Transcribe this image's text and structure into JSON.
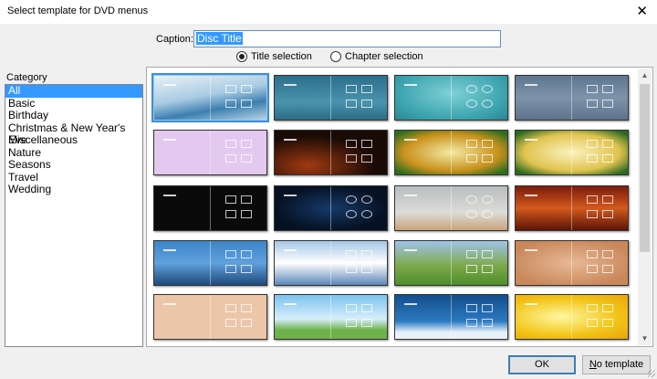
{
  "window": {
    "title": "Select template for DVD menus",
    "close_icon": "close-x-icon"
  },
  "caption": {
    "label": "Caption:",
    "value": "Disc Title"
  },
  "modes": [
    {
      "label": "Title selection",
      "selected": true
    },
    {
      "label": "Chapter selection",
      "selected": false
    }
  ],
  "category": {
    "label": "Category",
    "items": [
      "All",
      "Basic",
      "Birthday",
      "Christmas & New Year's Eve",
      "Miscellaneous",
      "Nature",
      "Seasons",
      "Travel",
      "Wedding"
    ],
    "selected": "All"
  },
  "templates": [
    {
      "bg": "linear-gradient(170deg,#e9f2f8 0%,#a9cbe2 45%,#3d7fb0 70%,#b7d3e6 100%)",
      "shape": "box",
      "selected": true
    },
    {
      "bg": "linear-gradient(180deg,#2c6f8c,#4a93ad 60%,#2a6c87)",
      "shape": "box"
    },
    {
      "bg": "radial-gradient(ellipse at 50% 40%,#7fd0d6,#3aa2ad 70%,#2b8691)",
      "shape": "circle"
    },
    {
      "bg": "linear-gradient(180deg,#5e7690,#7d93aa 50%,#5c738c)",
      "shape": "box"
    },
    {
      "bg": "#e3c9ef",
      "shape": "box"
    },
    {
      "bg": "radial-gradient(ellipse at 30% 80%,#a03a10,#1a0a05 60%)",
      "shape": "box"
    },
    {
      "bg": "radial-gradient(ellipse at 50% 50%,#f4e9a3,#c8911c 60%,#2e6e1e 90%)",
      "shape": "box"
    },
    {
      "bg": "radial-gradient(ellipse at 50% 50%,#fbf3c0,#e0c34e 60%,#2c6a22 90%)",
      "shape": "box"
    },
    {
      "bg": "#0a0a0a",
      "shape": "box"
    },
    {
      "bg": "radial-gradient(ellipse at 50% 50%,#163a6a,#061224 70%)",
      "shape": "circle"
    },
    {
      "bg": "linear-gradient(180deg,#b9bcbf,#dcdcd8 60%,#c9a37a)",
      "shape": "circle"
    },
    {
      "bg": "linear-gradient(180deg,#7a1b0c,#d45a1e 50%,#5a1408)",
      "shape": "box"
    },
    {
      "bg": "linear-gradient(180deg,#3d85c9,#5fa0dc 50%,#1f4a7c)",
      "shape": "box"
    },
    {
      "bg": "linear-gradient(180deg,#a4c6e6,#ffffff 50%,#5b86b9)",
      "shape": "box"
    },
    {
      "bg": "linear-gradient(180deg,#9fc4e9,#7fa94d 55%,#4e8e2b)",
      "shape": "box"
    },
    {
      "bg": "radial-gradient(ellipse at 50% 50%,#e7b995,#c9875a 80%)",
      "shape": "box"
    },
    {
      "bg": "#ecc6a9",
      "shape": "box"
    },
    {
      "bg": "linear-gradient(180deg,#7cc3ee,#d7eefb 55%,#6db24a 80%)",
      "shape": "box"
    },
    {
      "bg": "linear-gradient(180deg,#134e8c,#2c7ac1 60%,#e8f2fb 85%)",
      "shape": "box"
    },
    {
      "bg": "radial-gradient(ellipse at 40% 50%,#fff7a0,#f2c417 60%,#e8a40d)",
      "shape": "box"
    }
  ],
  "buttons": {
    "ok": "OK",
    "no_template": "No template"
  }
}
